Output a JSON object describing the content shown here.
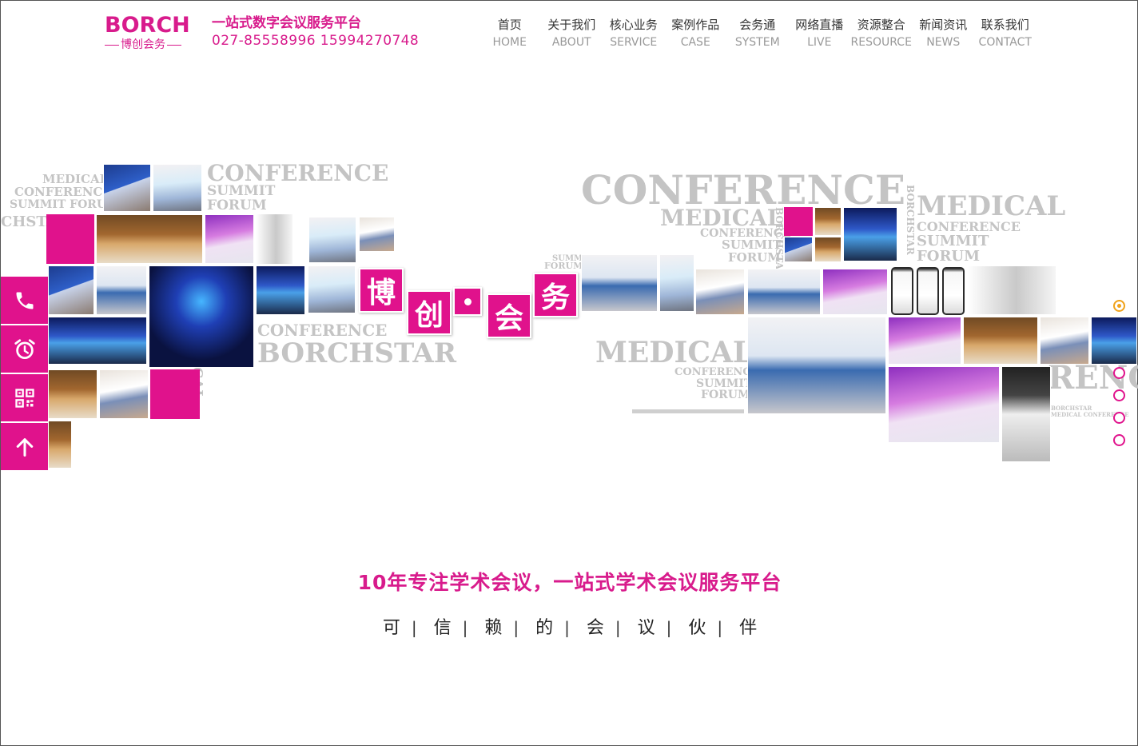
{
  "brand": {
    "logo_word": "BORCH",
    "logo_sub": "博创会务",
    "slogan_title": "一站式数字会议服务平台",
    "slogan_phones": "027-85558996  15994270748"
  },
  "nav": [
    {
      "cn": "首页",
      "en": "HOME"
    },
    {
      "cn": "关于我们",
      "en": "ABOUT"
    },
    {
      "cn": "核心业务",
      "en": "SERVICE"
    },
    {
      "cn": "案例作品",
      "en": "CASE"
    },
    {
      "cn": "会务通",
      "en": "SYSTEM"
    },
    {
      "cn": "网络直播",
      "en": "LIVE"
    },
    {
      "cn": "资源整合",
      "en": "RESOURCE"
    },
    {
      "cn": "新闻资讯",
      "en": "NEWS"
    },
    {
      "cn": "联系我们",
      "en": "CONTACT"
    }
  ],
  "collage": {
    "brand_chars": [
      "博",
      "创",
      "会",
      "务"
    ],
    "wm_left_small": [
      "MEDICAL",
      "CONFERENCE",
      "SUMMIT FORUM"
    ],
    "wm_left_cut": "CHSTA",
    "wm_conference_1": "CONFERENCE",
    "wm_summit": "SUMMIT",
    "wm_forum": "FORUM",
    "wm_conference_2": "CONFERENCE",
    "wm_borchstar": "BORCHSTAR",
    "wm_cal": "CAL",
    "wm_conference_big": "CONFERENCE",
    "wm_medical_1": "MEDICAL",
    "wm_conference_3": "CONFERENCE",
    "wm_summit_2": "SUMMIT",
    "wm_forum_2": "FORUM",
    "wm_borchstar_v": "BORCHSTAR",
    "wm_medical_big": "MEDICAL",
    "wm_conference_4": "CONFERENCE",
    "wm_summit_3": "SUMMIT",
    "wm_forum_3": "FORUM",
    "wm_summit_forum_tiny": [
      "SUMMIT",
      "FORUM"
    ],
    "wm_medical_mid": "MEDICAL",
    "wm_conference_5": "CONFERENCE",
    "wm_summit_4": "SUMMIT",
    "wm_forum_4": "FORUM",
    "wm_renc": "RENC",
    "wm_tiny_right": [
      "BORCHSTAR",
      "MEDICAL CONFERENCE"
    ]
  },
  "side_tools": [
    {
      "icon": "phone-icon"
    },
    {
      "icon": "alarm-clock-icon"
    },
    {
      "icon": "qr-code-icon"
    },
    {
      "icon": "arrow-up-icon"
    }
  ],
  "slider": {
    "active_index": 0,
    "count": 6
  },
  "tagline": "10年专注学术会议，一站式学术会议服务平台",
  "partner_chars": [
    "可",
    "信",
    "赖",
    "的",
    "会",
    "议",
    "伙",
    "伴"
  ],
  "partner_separator": "|",
  "colors": {
    "brand_pink": "#e0128c",
    "active_dot": "#f0a21a",
    "watermark_gray": "#c4c4c4"
  }
}
